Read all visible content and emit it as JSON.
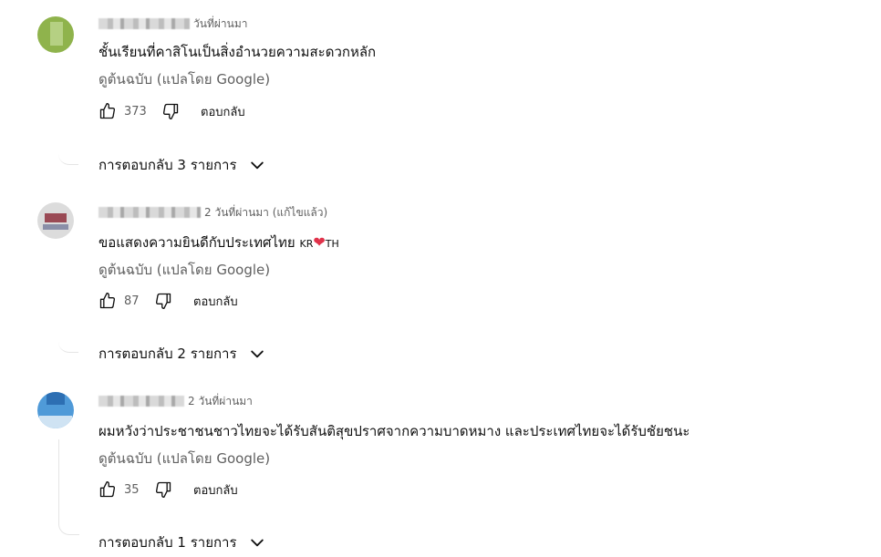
{
  "comments": [
    {
      "time": "วันที่ผ่านมา",
      "text": "ชั้นเรียนที่คาสิโนเป็นสิ่งอำนวยความสะดวกหลัก",
      "translate_label": "ดูต้นฉบับ (แปลโดย Google)",
      "likes": "373",
      "reply_label": "ตอบกลับ",
      "replies_label": "การตอบกลับ 3 รายการ",
      "avatar_color": "#8fb34c"
    },
    {
      "time": "2 วันที่ผ่านมา (แก้ไขแล้ว)",
      "text": "ขอแสดงความยินดีกับประเทศไทย",
      "flag_left": "KR",
      "heart": "❤",
      "flag_right": "TH",
      "translate_label": "ดูต้นฉบับ (แปลโดย Google)",
      "likes": "87",
      "reply_label": "ตอบกลับ",
      "replies_label": "การตอบกลับ 2 รายการ",
      "avatar_color": "#dcdcdc"
    },
    {
      "time": "2 วันที่ผ่านมา",
      "text": "ผมหวังว่าประชาชนชาวไทยจะได้รับสันติสุขปราศจากความบาดหมาง และประเทศไทยจะได้รับชัยชนะ",
      "translate_label": "ดูต้นฉบับ (แปลโดย Google)",
      "likes": "35",
      "reply_label": "ตอบกลับ",
      "replies_label": "การตอบกลับ 1 รายการ",
      "avatar_color": "#4f9ad8"
    }
  ]
}
